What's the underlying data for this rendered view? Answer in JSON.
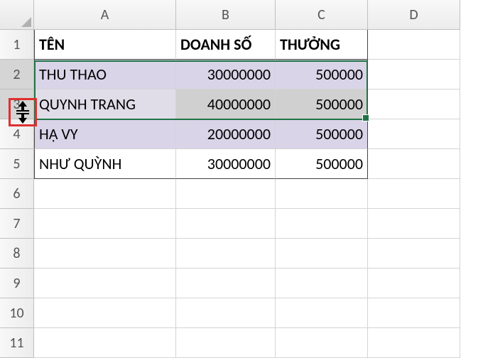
{
  "columns": [
    "A",
    "B",
    "C",
    "D"
  ],
  "rowNumbers": [
    "1",
    "2",
    "3",
    "4",
    "5",
    "6",
    "7",
    "8",
    "9",
    "10",
    "11"
  ],
  "headers": {
    "A": "TÊN",
    "B": "DOANH SỐ",
    "C": "THƯỞNG"
  },
  "rows": [
    {
      "A": "THU THAO",
      "B": "30000000",
      "C": "500000"
    },
    {
      "A": "QUYNH TRANG",
      "B": "40000000",
      "C": "500000"
    },
    {
      "A": "HẠ VY",
      "B": "20000000",
      "C": "500000"
    },
    {
      "A": "NHƯ QUỲNH",
      "B": "30000000",
      "C": "500000"
    }
  ],
  "cursor": {
    "type": "row-resize",
    "betweenRows": "3-4"
  },
  "selection": {
    "range": "A2:C3"
  }
}
